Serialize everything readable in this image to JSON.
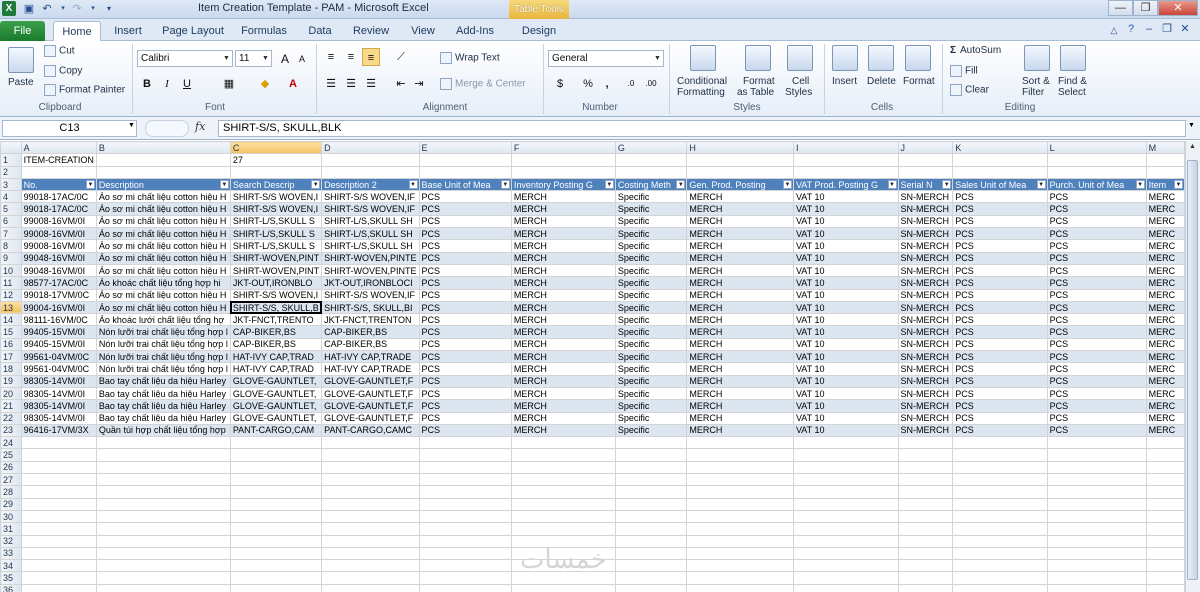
{
  "window": {
    "title": "Item Creation Template - PAM  -  Microsoft Excel",
    "contextual_tab_group": "Table Tools",
    "app_icon": "X",
    "controls": [
      "—",
      "❐",
      "✕"
    ]
  },
  "tabs": [
    "File",
    "Home",
    "Insert",
    "Page Layout",
    "Formulas",
    "Data",
    "Review",
    "View",
    "Add-Ins",
    "Design"
  ],
  "ribbon": {
    "clipboard": {
      "paste": "Paste",
      "cut": "Cut",
      "copy": "Copy",
      "format_painter": "Format Painter",
      "label": "Clipboard"
    },
    "font": {
      "name": "Calibri",
      "size": "11",
      "label": "Font",
      "bold": "B",
      "italic": "I",
      "underline": "U",
      "grow": "A",
      "shrink": "A"
    },
    "alignment": {
      "wrap_text": "Wrap Text",
      "merge_center": "Merge & Center",
      "label": "Alignment"
    },
    "number": {
      "format": "General",
      "currency": "$",
      "percent": "%",
      "comma": ",",
      "label": "Number"
    },
    "styles": {
      "conditional": "Conditional",
      "conditional2": "Formatting",
      "format_as": "Format",
      "format_as2": "as Table",
      "cell_styles": "Cell",
      "cell_styles2": "Styles",
      "label": "Styles"
    },
    "cells": {
      "insert": "Insert",
      "delete": "Delete",
      "format": "Format",
      "label": "Cells"
    },
    "editing": {
      "autosum": "AutoSum",
      "fill": "Fill",
      "clear": "Clear",
      "sort": "Sort &",
      "sort2": "Filter",
      "find": "Find &",
      "find2": "Select",
      "label": "Editing"
    }
  },
  "formula_bar": {
    "name_box": "C13",
    "fx": "fx",
    "formula": "SHIRT-S/S, SKULL,BLK"
  },
  "sheet": {
    "columns": [
      "A",
      "B",
      "C",
      "D",
      "E",
      "F",
      "G",
      "H",
      "I",
      "J",
      "K",
      "L",
      "M"
    ],
    "selected_column": "C",
    "selected_row": 13,
    "row1": {
      "a": "ITEM-CREATION",
      "c": "27"
    },
    "headers": [
      "No.",
      "Description",
      "Search Descrip",
      "Description 2",
      "Base Unit of Mea",
      "Inventory Posting G",
      "Costing Meth",
      "Gen. Prod. Posting",
      "VAT Prod. Posting G",
      "Serial N",
      "Sales Unit of Mea",
      "Purch. Unit of Mea",
      "Item"
    ],
    "rows": [
      [
        "99018-17AC/0C",
        "Áo sơ mi chất liệu cotton hiệu H",
        "SHIRT-S/S WOVEN,I",
        "SHIRT-S/S WOVEN,IF",
        "PCS",
        "MERCH",
        "Specific",
        "MERCH",
        "VAT 10",
        "SN-MERCH",
        "PCS",
        "PCS",
        "MERC"
      ],
      [
        "99018-17AC/0C",
        "Áo sơ mi chất liệu cotton hiệu H",
        "SHIRT-S/S WOVEN,I",
        "SHIRT-S/S WOVEN,IF",
        "PCS",
        "MERCH",
        "Specific",
        "MERCH",
        "VAT 10",
        "SN-MERCH",
        "PCS",
        "PCS",
        "MERC"
      ],
      [
        "99008-16VM/0I",
        "Áo sơ mi chất liệu cotton hiệu H",
        "SHIRT-L/S,SKULL S",
        "SHIRT-L/S,SKULL SH",
        "PCS",
        "MERCH",
        "Specific",
        "MERCH",
        "VAT 10",
        "SN-MERCH",
        "PCS",
        "PCS",
        "MERC"
      ],
      [
        "99008-16VM/0I",
        "Áo sơ mi chất liệu cotton hiệu H",
        "SHIRT-L/S,SKULL S",
        "SHIRT-L/S,SKULL SH",
        "PCS",
        "MERCH",
        "Specific",
        "MERCH",
        "VAT 10",
        "SN-MERCH",
        "PCS",
        "PCS",
        "MERC"
      ],
      [
        "99008-16VM/0I",
        "Áo sơ mi chất liệu cotton hiệu H",
        "SHIRT-L/S,SKULL S",
        "SHIRT-L/S,SKULL SH",
        "PCS",
        "MERCH",
        "Specific",
        "MERCH",
        "VAT 10",
        "SN-MERCH",
        "PCS",
        "PCS",
        "MERC"
      ],
      [
        "99048-16VM/0I",
        "Áo sơ mi chất liệu cotton hiệu H",
        "SHIRT-WOVEN,PINT",
        "SHIRT-WOVEN,PINTE",
        "PCS",
        "MERCH",
        "Specific",
        "MERCH",
        "VAT 10",
        "SN-MERCH",
        "PCS",
        "PCS",
        "MERC"
      ],
      [
        "99048-16VM/0I",
        "Áo sơ mi chất liệu cotton hiệu H",
        "SHIRT-WOVEN,PINT",
        "SHIRT-WOVEN,PINTE",
        "PCS",
        "MERCH",
        "Specific",
        "MERCH",
        "VAT 10",
        "SN-MERCH",
        "PCS",
        "PCS",
        "MERC"
      ],
      [
        "98577-17AC/0C",
        "Áo khoác chất liệu tổng hợp hi",
        "JKT-OUT,IRONBLO",
        "JKT-OUT,IRONBLOCI",
        "PCS",
        "MERCH",
        "Specific",
        "MERCH",
        "VAT 10",
        "SN-MERCH",
        "PCS",
        "PCS",
        "MERC"
      ],
      [
        "99018-17VM/0C",
        "Áo sơ mi chất liệu cotton hiệu H",
        "SHIRT-S/S WOVEN,I",
        "SHIRT-S/S WOVEN,IF",
        "PCS",
        "MERCH",
        "Specific",
        "MERCH",
        "VAT 10",
        "SN-MERCH",
        "PCS",
        "PCS",
        "MERC"
      ],
      [
        "99004-16VM/0I",
        "Áo sơ mi chất liệu cotton hiệu H",
        "SHIRT-S/S, SKULL,B",
        "SHIRT-S/S, SKULL,BI",
        "PCS",
        "MERCH",
        "Specific",
        "MERCH",
        "VAT 10",
        "SN-MERCH",
        "PCS",
        "PCS",
        "MERC"
      ],
      [
        "98111-16VM/0C",
        "Áo khoác lưới chất liệu tổng hợ",
        "JKT-FNCT,TRENTO",
        "JKT-FNCT,TRENTON",
        "PCS",
        "MERCH",
        "Specific",
        "MERCH",
        "VAT 10",
        "SN-MERCH",
        "PCS",
        "PCS",
        "MERC"
      ],
      [
        "99405-15VM/0I",
        "Nón lưỡi trai chất liệu tổng hợp l",
        "CAP-BIKER,BS",
        "CAP-BIKER,BS",
        "PCS",
        "MERCH",
        "Specific",
        "MERCH",
        "VAT 10",
        "SN-MERCH",
        "PCS",
        "PCS",
        "MERC"
      ],
      [
        "99405-15VM/0I",
        "Nón lưỡi trai chất liệu tổng hợp l",
        "CAP-BIKER,BS",
        "CAP-BIKER,BS",
        "PCS",
        "MERCH",
        "Specific",
        "MERCH",
        "VAT 10",
        "SN-MERCH",
        "PCS",
        "PCS",
        "MERC"
      ],
      [
        "99561-04VM/0C",
        "Nón lưỡi trai chất liệu tổng hợp l",
        "HAT-IVY CAP,TRAD",
        "HAT-IVY CAP,TRADE",
        "PCS",
        "MERCH",
        "Specific",
        "MERCH",
        "VAT 10",
        "SN-MERCH",
        "PCS",
        "PCS",
        "MERC"
      ],
      [
        "99561-04VM/0C",
        "Nón lưỡi trai chất liệu tổng hợp l",
        "HAT-IVY CAP,TRAD",
        "HAT-IVY CAP,TRADE",
        "PCS",
        "MERCH",
        "Specific",
        "MERCH",
        "VAT 10",
        "SN-MERCH",
        "PCS",
        "PCS",
        "MERC"
      ],
      [
        "98305-14VM/0I",
        "Bao tay chất liệu da hiệu Harley",
        "GLOVE-GAUNTLET,",
        "GLOVE-GAUNTLET,F",
        "PCS",
        "MERCH",
        "Specific",
        "MERCH",
        "VAT 10",
        "SN-MERCH",
        "PCS",
        "PCS",
        "MERC"
      ],
      [
        "98305-14VM/0I",
        "Bao tay chất liệu da hiệu Harley",
        "GLOVE-GAUNTLET,",
        "GLOVE-GAUNTLET,F",
        "PCS",
        "MERCH",
        "Specific",
        "MERCH",
        "VAT 10",
        "SN-MERCH",
        "PCS",
        "PCS",
        "MERC"
      ],
      [
        "98305-14VM/0I",
        "Bao tay chất liệu da hiệu Harley",
        "GLOVE-GAUNTLET,",
        "GLOVE-GAUNTLET,F",
        "PCS",
        "MERCH",
        "Specific",
        "MERCH",
        "VAT 10",
        "SN-MERCH",
        "PCS",
        "PCS",
        "MERC"
      ],
      [
        "98305-14VM/0I",
        "Bao tay chất liệu da hiệu Harley",
        "GLOVE-GAUNTLET,",
        "GLOVE-GAUNTLET,F",
        "PCS",
        "MERCH",
        "Specific",
        "MERCH",
        "VAT 10",
        "SN-MERCH",
        "PCS",
        "PCS",
        "MERC"
      ],
      [
        "96416-17VM/3X",
        "Quần túi hợp chất liệu tổng hợp",
        "PANT-CARGO,CAM",
        "PANT-CARGO,CAMC",
        "PCS",
        "MERCH",
        "Specific",
        "MERCH",
        "VAT 10",
        "SN-MERCH",
        "PCS",
        "PCS",
        "MERC"
      ]
    ],
    "empty_rows_start": 24,
    "empty_rows_end": 37
  },
  "watermark": "خمسات",
  "colors": {
    "header_blue": "#4f81bd",
    "band": "#dce6f1",
    "file_tab": "#1b7a2d",
    "selection": "#f3c261"
  }
}
